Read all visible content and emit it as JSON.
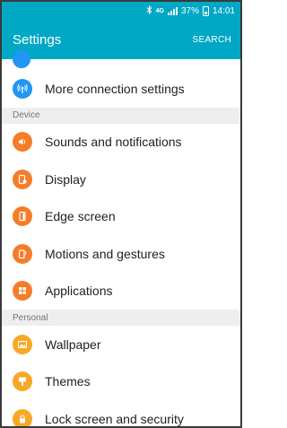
{
  "status_bar": {
    "network": "4G",
    "battery": "37%",
    "time": "14:01"
  },
  "app_bar": {
    "title": "Settings",
    "action": "SEARCH"
  },
  "top_items": [
    {
      "label": "More connection settings",
      "icon": "signal-broadcast-icon",
      "color": "#2196f3"
    }
  ],
  "sections": [
    {
      "header": "Device",
      "items": [
        {
          "label": "Sounds and notifications",
          "icon": "speaker-icon",
          "color": "#f57c29"
        },
        {
          "label": "Display",
          "icon": "display-icon",
          "color": "#f57c29"
        },
        {
          "label": "Edge screen",
          "icon": "edge-screen-icon",
          "color": "#f57c29"
        },
        {
          "label": "Motions and gestures",
          "icon": "motion-icon",
          "color": "#f57c29"
        },
        {
          "label": "Applications",
          "icon": "apps-grid-icon",
          "color": "#f57c29"
        }
      ]
    },
    {
      "header": "Personal",
      "items": [
        {
          "label": "Wallpaper",
          "icon": "image-icon",
          "color": "#f9a825"
        },
        {
          "label": "Themes",
          "icon": "brush-icon",
          "color": "#f9a825"
        },
        {
          "label": "Lock screen and security",
          "icon": "lock-icon",
          "color": "#f9a825"
        }
      ]
    }
  ]
}
